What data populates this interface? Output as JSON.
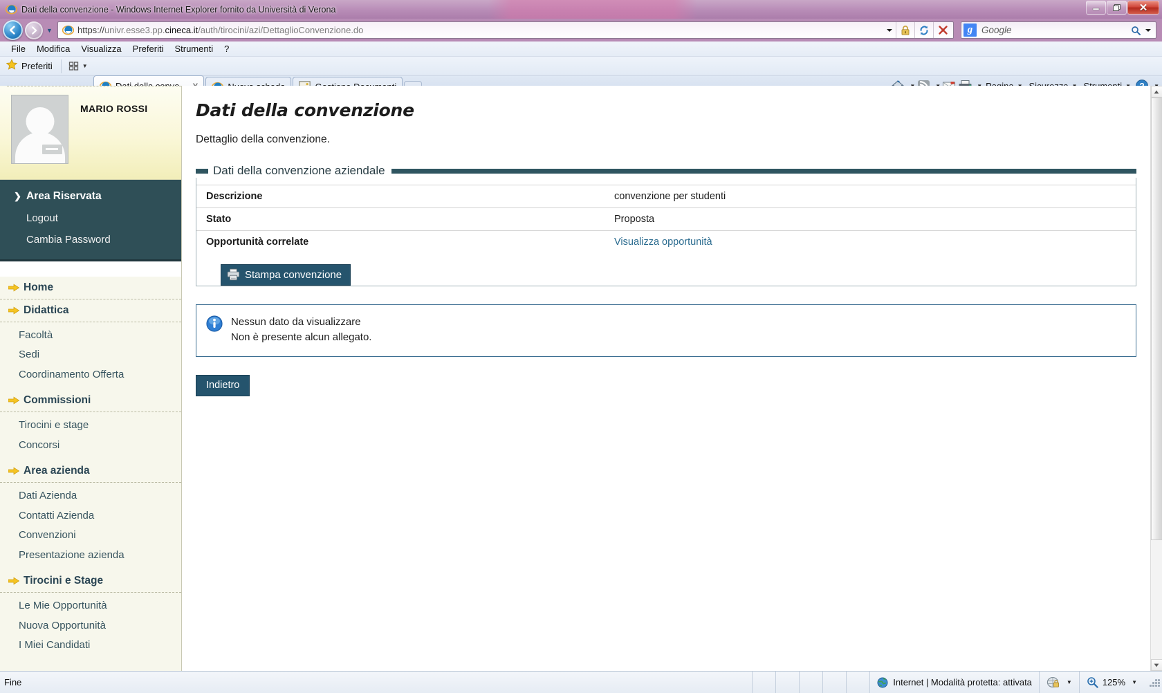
{
  "window": {
    "title": "Dati della convenzione - Windows Internet Explorer fornito da Università di Verona",
    "minimize_label": "—",
    "maximize_label": "❐",
    "close_label": "✕"
  },
  "browser": {
    "url_scheme": "https://",
    "url_host_pre": "univr.esse3.pp.",
    "url_host_bold": "cineca.it",
    "url_path": "/auth/tirocini/azi/DettaglioConvenzione.do",
    "url_full": "https://univr.esse3.pp.cineca.it/auth/tirocini/azi/DettaglioConvenzione.do",
    "search_placeholder": "Google",
    "search_engine_letter": "g",
    "back_tooltip": "Indietro",
    "forward_tooltip": "Avanti",
    "menu": [
      "File",
      "Modifica",
      "Visualizza",
      "Preferiti",
      "Strumenti",
      "?"
    ],
    "favorites_label": "Preferiti",
    "tabs": [
      {
        "label": "Dati della conve...",
        "close": "X",
        "active": true
      },
      {
        "label": "Nuova scheda",
        "close": "",
        "active": false
      },
      {
        "label": "Gestione Documenti",
        "close": "",
        "active": false
      }
    ],
    "command_bar": [
      "Pagina",
      "Sicurezza",
      "Strumenti"
    ],
    "command_icons": [
      "home-icon",
      "feeds-icon",
      "read-mail-icon",
      "print-icon",
      "help-icon"
    ]
  },
  "statusbar": {
    "left_text": "Fine",
    "zone_text": "Internet | Modalità protetta: attivata",
    "zoom_text": "125%"
  },
  "sidebar": {
    "user": {
      "name": "MARIO ROSSI"
    },
    "reserved_area": {
      "title": "Area Riservata",
      "items": [
        "Logout",
        "Cambia Password"
      ]
    },
    "groups": [
      {
        "title": "Home",
        "items": []
      },
      {
        "title": "Didattica",
        "items": [
          "Facoltà",
          "Sedi",
          "Coordinamento Offerta"
        ]
      },
      {
        "title": "Commissioni",
        "items": [
          "Tirocini e stage",
          "Concorsi"
        ]
      },
      {
        "title": "Area azienda",
        "items": [
          "Dati Azienda",
          "Contatti Azienda",
          "Convenzioni",
          "Presentazione azienda"
        ]
      },
      {
        "title": "Tirocini e Stage",
        "items": [
          "Le Mie Opportunità",
          "Nuova Opportunità",
          "I Miei Candidati"
        ]
      }
    ]
  },
  "content": {
    "title": "Dati della convenzione",
    "subtitle": "Dettaglio della convenzione.",
    "fieldset_legend": "Dati della convenzione aziendale",
    "rows": [
      {
        "label": "Descrizione",
        "value": "convenzione per studenti",
        "is_link": false
      },
      {
        "label": "Stato",
        "value": "Proposta",
        "is_link": false
      },
      {
        "label": "Opportunità correlate",
        "value": "Visualizza opportunità",
        "is_link": true
      }
    ],
    "print_button": "Stampa convenzione",
    "info_line1": "Nessun dato da visualizzare",
    "info_line2": "Non è presente alcun allegato.",
    "back_button": "Indietro"
  },
  "colors": {
    "accent_dark": "#2f5560",
    "button_blue": "#25546d",
    "sidebar_bg": "#f7f7ec",
    "dark_menu": "#2f4f57",
    "link": "#2a6b8f",
    "arrow_yellow": "#f5c423",
    "titlebar": "#b88cb7"
  }
}
